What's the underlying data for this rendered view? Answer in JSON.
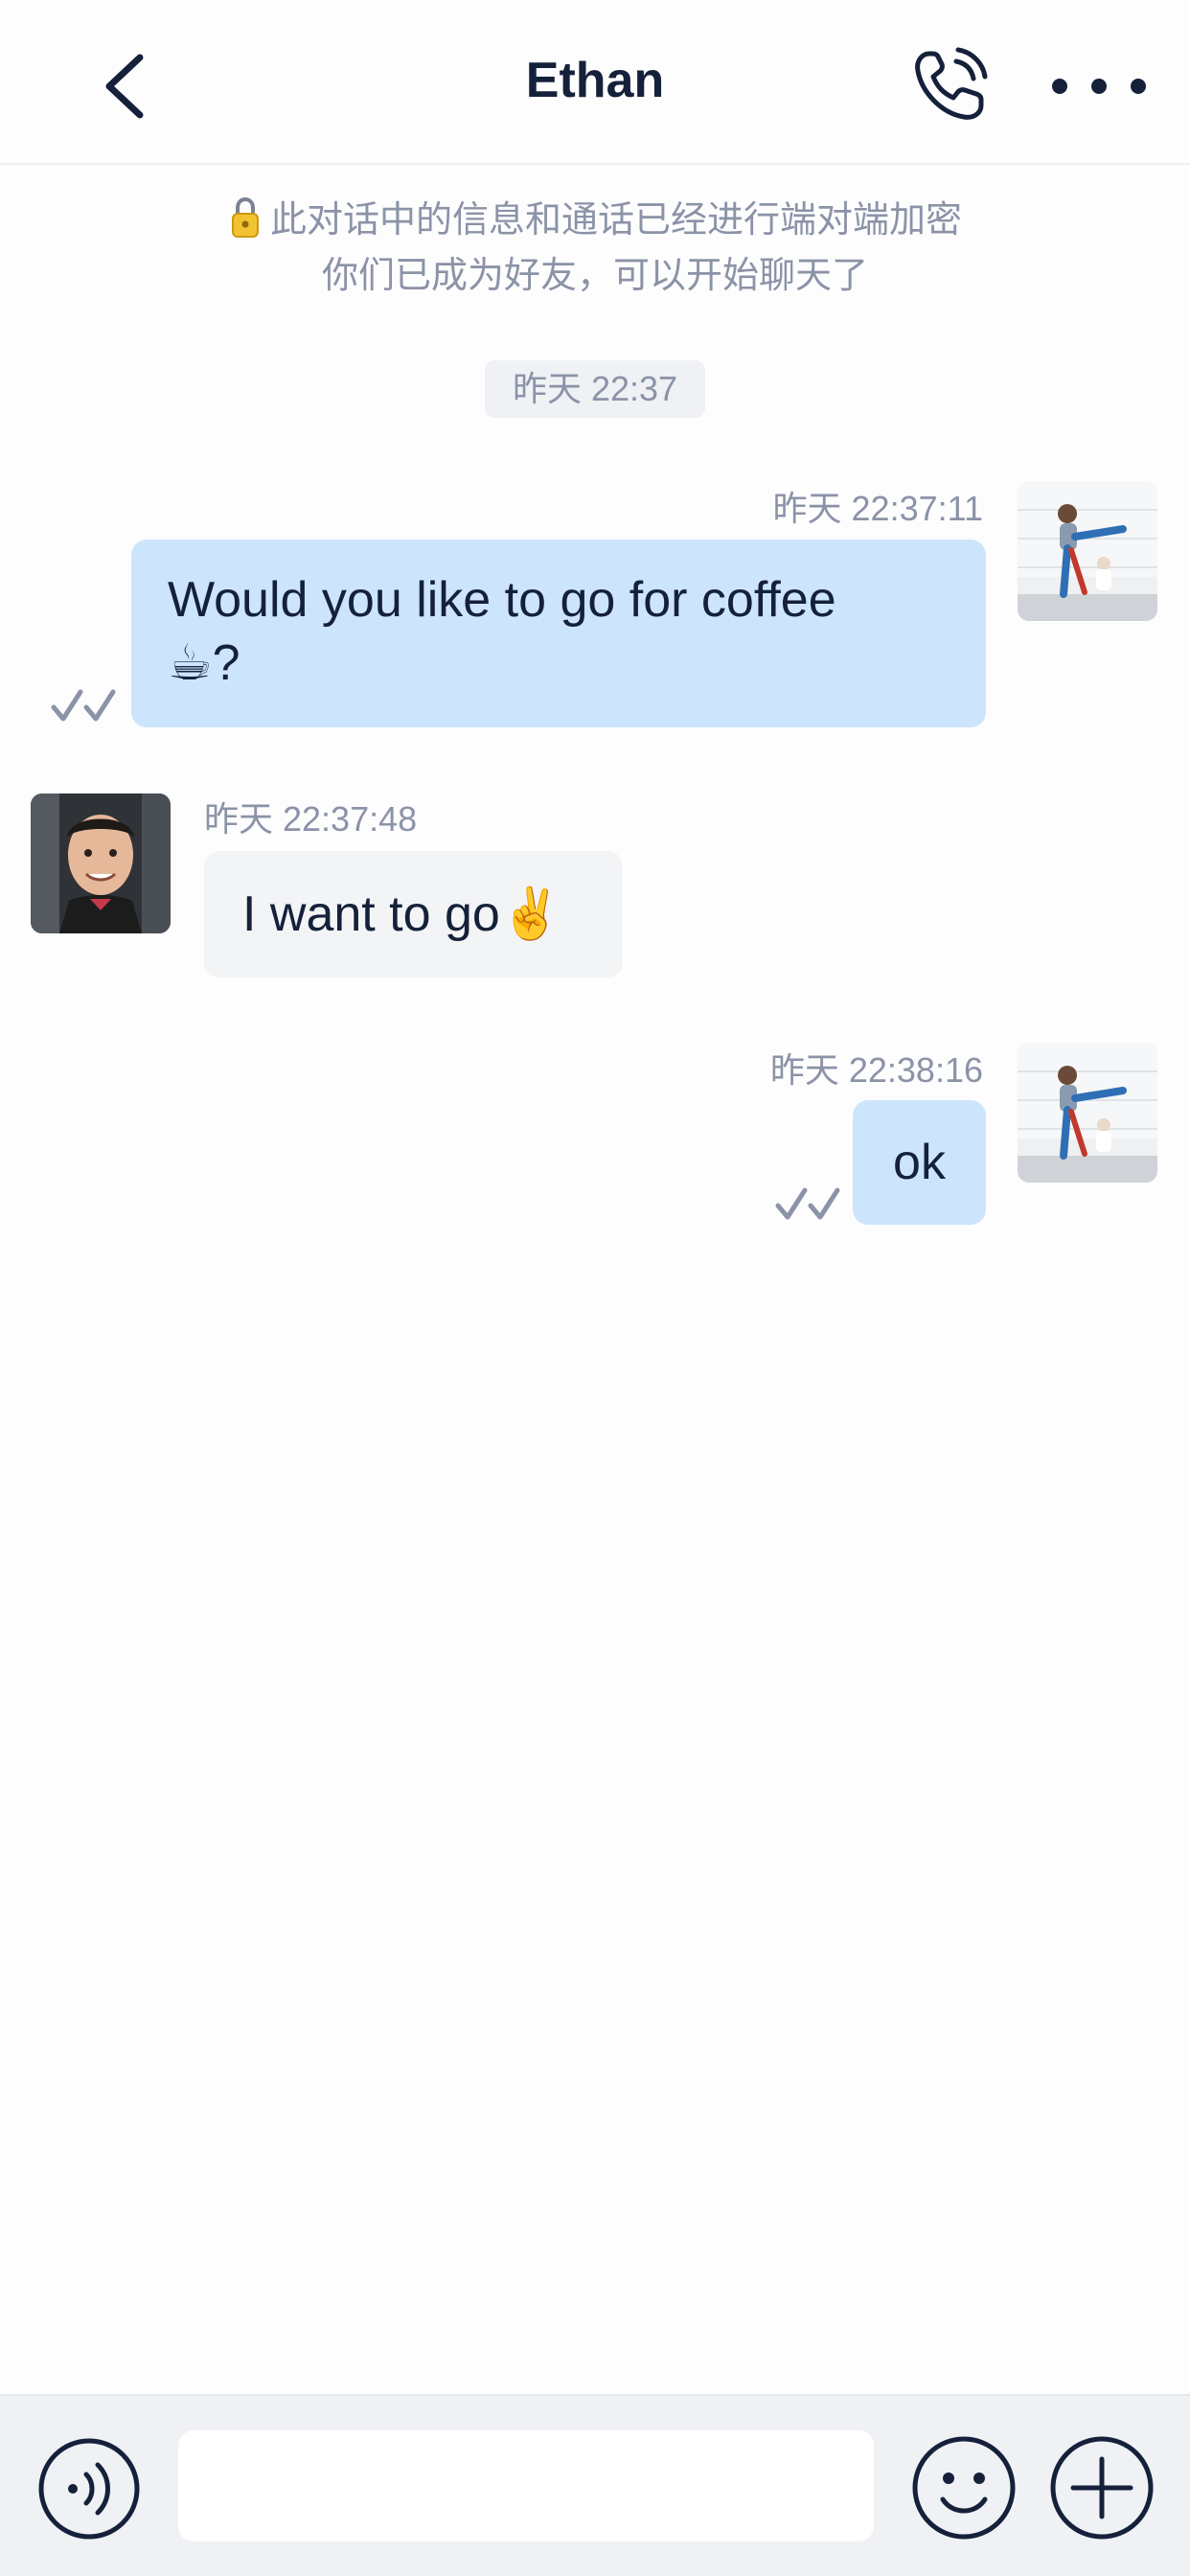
{
  "header": {
    "title": "Ethan",
    "back_icon": "chevron-left-icon",
    "call_icon": "phone-icon",
    "more_icon": "more-horizontal-icon"
  },
  "notices": {
    "encryption": "此对话中的信息和通话已经进行端对端加密",
    "friends": "你们已成为好友，可以开始聊天了"
  },
  "time_chip": "昨天 22:37",
  "messages": [
    {
      "direction": "outgoing",
      "time": "昨天 22:37:11",
      "text_line1": "Would you like to go for coffee",
      "text_line2": "☕?",
      "status": "read"
    },
    {
      "direction": "incoming",
      "time": "昨天 22:37:48",
      "text": "I want to go✌️"
    },
    {
      "direction": "outgoing",
      "time": "昨天 22:38:16",
      "text": "ok",
      "status": "read"
    }
  ],
  "input_bar": {
    "value": "",
    "voice_icon": "voice-icon",
    "emoji_icon": "emoji-icon",
    "plus_icon": "plus-circle-icon"
  },
  "colors": {
    "outgoing_bubble": "#cce5fd",
    "incoming_bubble": "#f3f4f6",
    "meta_text": "#8b93a7",
    "title_text": "#15213a"
  }
}
